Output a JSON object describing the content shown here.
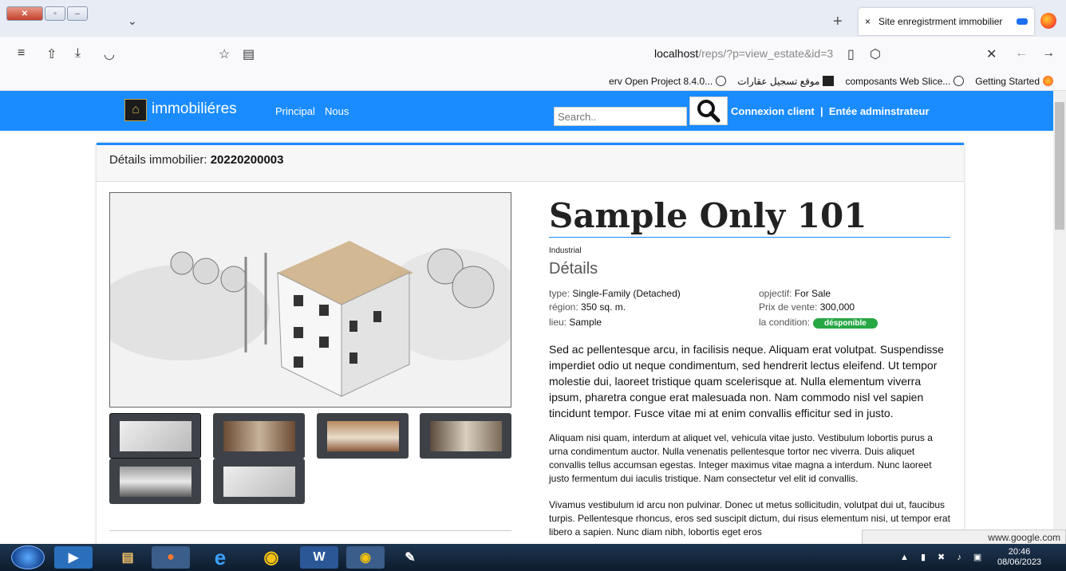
{
  "browser": {
    "tab_title": "Site enregistrment immobilier",
    "tab_close": "×",
    "new_tab": "+",
    "tab_list": "⌄",
    "url_host": "localhost",
    "url_path": "/reps/?p=view_estate&id=3",
    "bookmarks": [
      {
        "label": "Getting Started",
        "icon": "firefox-icon"
      },
      {
        "label": "composants Web Slice...",
        "icon": "globe-icon"
      },
      {
        "label": "موقع تسجيل عقارات",
        "icon": "site-icon"
      },
      {
        "label": "erv Open Project 8.4.0...",
        "icon": "globe-icon"
      }
    ],
    "status_url": "www.google.com"
  },
  "site": {
    "brand": "immobiliéres",
    "nav": [
      "Principal",
      "Nous"
    ],
    "search_placeholder": "Search..",
    "links": "Connexion client  |  Entée adminstrateur"
  },
  "card": {
    "title_label": "Détails immobilier:",
    "title_code": "20220200003"
  },
  "property": {
    "name": "Sample Only 101",
    "category": "Industrial",
    "details_heading": "Détails",
    "details": {
      "type_label": "type:",
      "type_value": "Single-Family (Detached)",
      "objective_label": "opjectif:",
      "objective_value": "For Sale",
      "region_label": "région:",
      "region_value": "350 sq. m.",
      "price_label": "Prix de vente:",
      "price_value": "300,000",
      "location_label": "lieu:",
      "location_value": "Sample",
      "condition_label": "la condition:",
      "condition_value": "désponible"
    },
    "paragraphs": [
      "Sed ac pellentesque arcu, in facilisis neque. Aliquam erat volutpat. Suspendisse imperdiet odio ut neque condimentum, sed hendrerit lectus eleifend. Ut tempor molestie dui, laoreet tristique quam scelerisque at. Nulla elementum viverra ipsum, pharetra congue erat malesuada non. Nam commodo nisl vel sapien tincidunt tempor. Fusce vitae mi at enim convallis efficitur sed in justo.",
      "Aliquam nisi quam, interdum at aliquet vel, vehicula vitae justo. Vestibulum lobortis purus a urna condimentum auctor. Nulla venenatis pellentesque tortor nec viverra. Duis aliquet convallis tellus accumsan egestas. Integer maximus vitae magna a interdum. Nunc laoreet justo fermentum dui iaculis tristique. Nam consectetur vel elit id convallis.",
      "Vivamus vestibulum id arcu non pulvinar. Donec ut metus sollicitudin, volutpat dui ut, faucibus turpis. Pellentesque rhoncus, eros sed suscipit dictum, dui risus elementum nisi, ut tempor erat libero a sapien. Nunc diam nibh, lobortis eget eros"
    ]
  },
  "taskbar": {
    "time": "20:46",
    "date": "08/06/2023"
  },
  "colors": {
    "header_blue": "#1a8cff",
    "badge_green": "#28a745"
  }
}
